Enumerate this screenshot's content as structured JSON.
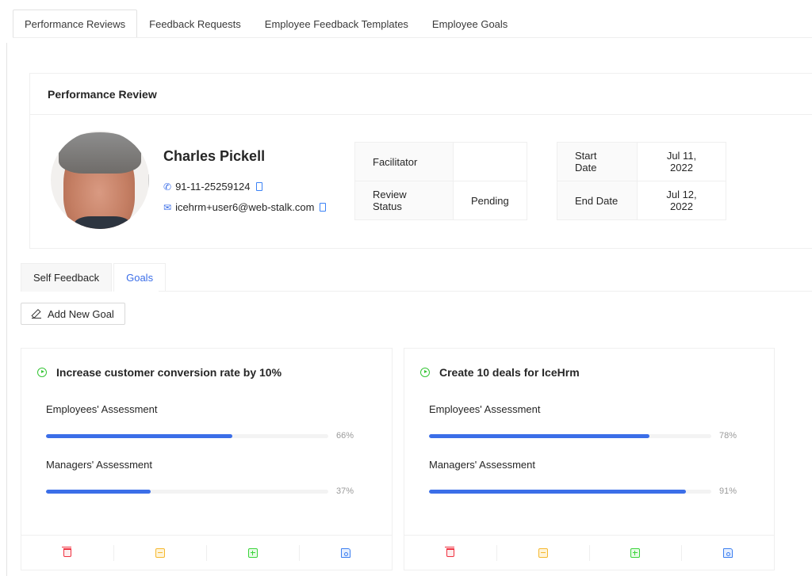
{
  "top_tabs": [
    {
      "label": "Performance Reviews",
      "active": true
    },
    {
      "label": "Feedback Requests",
      "active": false
    },
    {
      "label": "Employee Feedback Templates",
      "active": false
    },
    {
      "label": "Employee Goals",
      "active": false
    }
  ],
  "review": {
    "title": "Performance Review",
    "employee": {
      "name": "Charles Pickell",
      "phone": "91-11-25259124",
      "email": "icehrm+user6@web-stalk.com"
    },
    "details_left": [
      {
        "label": "Facilitator",
        "value": ""
      },
      {
        "label": "Review Status",
        "value": "Pending"
      }
    ],
    "details_right": [
      {
        "label": "Start Date",
        "value": "Jul 11, 2022"
      },
      {
        "label": "End Date",
        "value": "Jul 12, 2022"
      }
    ]
  },
  "inner_tabs": [
    {
      "label": "Self Feedback",
      "active": false
    },
    {
      "label": "Goals",
      "active": true
    }
  ],
  "add_goal_label": "Add New Goal",
  "goals": [
    {
      "title": "Increase customer conversion rate by 10%",
      "assessments": [
        {
          "label": "Employees' Assessment",
          "percent": 66,
          "text": "66%"
        },
        {
          "label": "Managers' Assessment",
          "percent": 37,
          "text": "37%"
        }
      ]
    },
    {
      "title": "Create 10 deals for IceHrm",
      "assessments": [
        {
          "label": "Employees' Assessment",
          "percent": 78,
          "text": "78%"
        },
        {
          "label": "Managers' Assessment",
          "percent": 91,
          "text": "91%"
        }
      ]
    }
  ],
  "goal_actions": [
    "delete-icon",
    "minus-square-icon",
    "plus-square-icon",
    "save-icon"
  ],
  "colors": {
    "accent": "#3b6ee8",
    "delete": "#f0303f",
    "minus": "#f5b82e",
    "plus": "#3ad43a",
    "save": "#3b7ef0",
    "goal_status": "#36c536"
  }
}
